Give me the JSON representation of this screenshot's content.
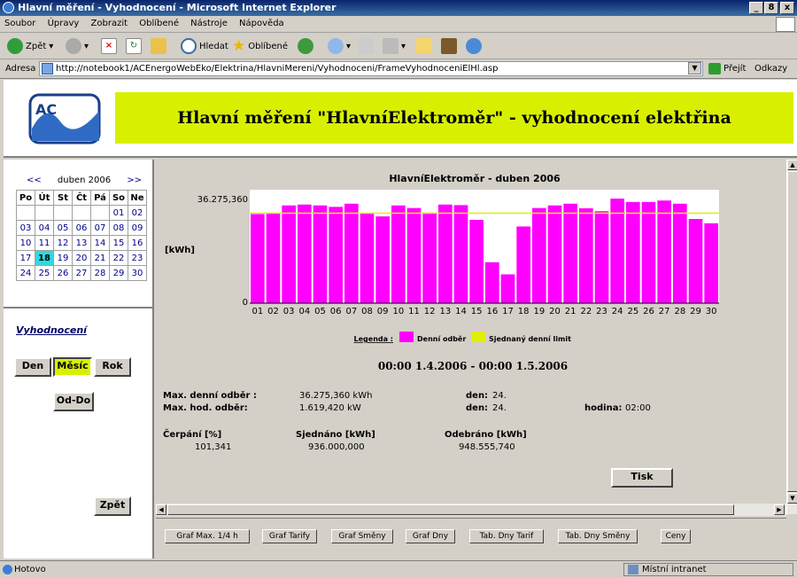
{
  "window": {
    "title": "Hlavní měření - Vyhodnocení - Microsoft Internet Explorer",
    "btn_min": "_",
    "btn_max": "8",
    "btn_close": "x"
  },
  "menu": [
    "Soubor",
    "Úpravy",
    "Zobrazit",
    "Oblíbené",
    "Nástroje",
    "Nápověda"
  ],
  "toolbar": {
    "back": "Zpět",
    "search": "Hledat",
    "favorites": "Oblíbené"
  },
  "address": {
    "label": "Adresa",
    "url": "http://notebook1/ACEnergoWebEko/Elektrina/HlavniMereni/Vyhodnoceni/FrameVyhodnoceniElHl.asp",
    "go": "Přejít",
    "links": "Odkazy"
  },
  "header": {
    "title": "Hlavní měření \"HlavníElektroměr\" - vyhodnocení elektřina",
    "logo": "AC"
  },
  "calendar": {
    "prev": "<<",
    "next": ">>",
    "month": "duben 2006",
    "days": [
      "Po",
      "Út",
      "St",
      "Čt",
      "Pá",
      "So",
      "Ne"
    ],
    "weeks": [
      [
        "",
        "",
        "",
        "",
        "",
        "01",
        "02"
      ],
      [
        "03",
        "04",
        "05",
        "06",
        "07",
        "08",
        "09"
      ],
      [
        "10",
        "11",
        "12",
        "13",
        "14",
        "15",
        "16"
      ],
      [
        "17",
        "18",
        "19",
        "20",
        "21",
        "22",
        "23"
      ],
      [
        "24",
        "25",
        "26",
        "27",
        "28",
        "29",
        "30"
      ]
    ],
    "today": "18"
  },
  "left": {
    "section": "Vyhodnocení",
    "den": "Den",
    "mesic": "Měsíc",
    "rok": "Rok",
    "oddo": "Od-Do",
    "zpet": "Zpět"
  },
  "chart_data": {
    "type": "bar",
    "title": "HlavníElektroměr - duben 2006",
    "ylabel": "[kWh]",
    "ytick_top": "36.275,360",
    "ytick_zero": "0",
    "ymax": 36275.36,
    "limit": 31200,
    "categories": [
      "01",
      "02",
      "03",
      "04",
      "05",
      "06",
      "07",
      "08",
      "09",
      "10",
      "11",
      "12",
      "13",
      "14",
      "15",
      "16",
      "17",
      "18",
      "19",
      "20",
      "21",
      "22",
      "23",
      "24",
      "25",
      "26",
      "27",
      "28",
      "29",
      "30"
    ],
    "values": [
      30900,
      31300,
      33900,
      34200,
      33900,
      33400,
      34500,
      31100,
      30100,
      33900,
      33000,
      31400,
      34200,
      34000,
      28900,
      14200,
      10000,
      26600,
      33000,
      33900,
      34500,
      32900,
      31900,
      36275,
      35100,
      35100,
      35600,
      34500,
      29200,
      27700
    ],
    "colors": {
      "bar": "#ff00ff",
      "limit": "#e0f000"
    },
    "legend_title": "Legenda :",
    "legend": [
      "Denní odběr",
      "Sjednaný denní limit"
    ]
  },
  "range": "00:00 1.4.2006  -  00:00 1.5.2006",
  "stats": {
    "max_den_label": "Max. denní odběr :",
    "max_den_value": "36.275,360 kWh",
    "max_den_den_label": "den:",
    "max_den_den": "24.",
    "max_hod_label": "Max. hod. odběr:",
    "max_hod_value": "1.619,420 kW",
    "max_hod_den_label": "den:",
    "max_hod_den": "24.",
    "hodina_label": "hodina:",
    "hodina": "02:00",
    "cerpani_label": "Čerpání [%]",
    "cerpani": "101,341",
    "sjednano_label": "Sjednáno [kWh]",
    "sjednano": "936.000,000",
    "odebrano_label": "Odebráno [kWh]",
    "odebrano": "948.555,740",
    "tisk": "Tisk"
  },
  "bottom_buttons": [
    "Graf Max. 1/4 h",
    "Graf Tarify",
    "Graf Směny",
    "Graf Dny",
    "Tab. Dny Tarif",
    "Tab. Dny Směny",
    "Ceny"
  ],
  "status": {
    "text": "Hotovo",
    "zone": "Místní intranet"
  }
}
